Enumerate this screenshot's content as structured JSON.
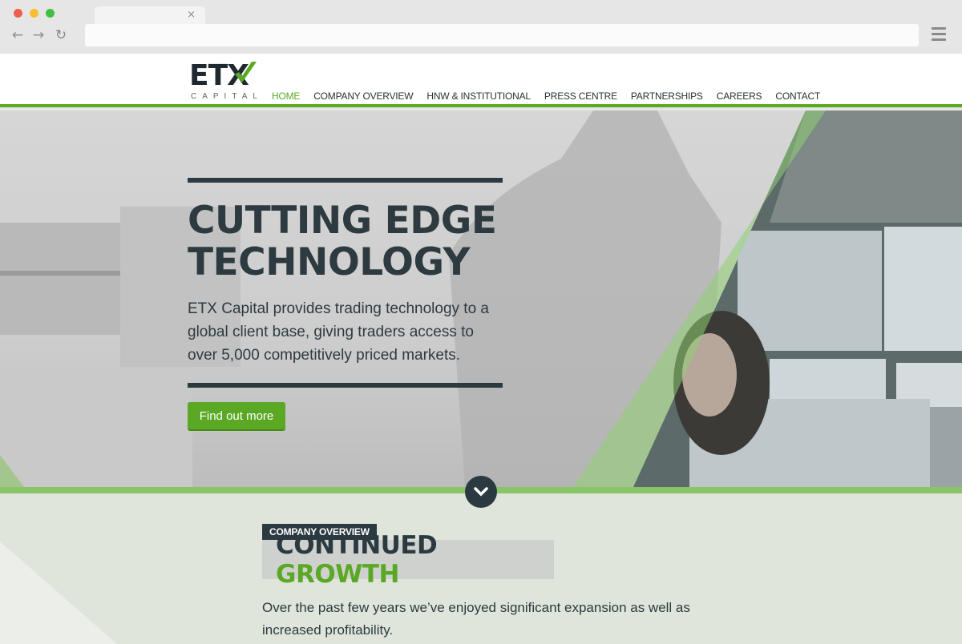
{
  "browser": {
    "tab_close": "×",
    "back_icon": "←",
    "forward_icon": "→",
    "reload_icon": "↻"
  },
  "logo": {
    "mark": "ETX",
    "sub": "CAPITAL"
  },
  "nav": {
    "items": [
      {
        "label": "HOME",
        "active": true
      },
      {
        "label": "COMPANY OVERVIEW"
      },
      {
        "label": "HNW & INSTITUTIONAL"
      },
      {
        "label": "PRESS CENTRE"
      },
      {
        "label": "PARTNERSHIPS"
      },
      {
        "label": "CAREERS"
      },
      {
        "label": "CONTACT"
      }
    ]
  },
  "hero": {
    "title_line1": "CUTTING EDGE",
    "title_line2": "TECHNOLOGY",
    "description": "ETX Capital provides trading technology to a global client base, giving traders access to over 5,000 competitively priced markets.",
    "cta_label": "Find out more"
  },
  "overview": {
    "eyebrow": "COMPANY OVERVIEW",
    "headline_part1": "CONTINUED",
    "headline_part2": "GROWTH",
    "description": "Over the past few years we’ve enjoyed significant expansion as well as increased profitability."
  },
  "colors": {
    "brand_green": "#5aa824",
    "dark": "#2b3a40",
    "light_green": "#8ac469",
    "section_bg": "#dfe5da"
  }
}
